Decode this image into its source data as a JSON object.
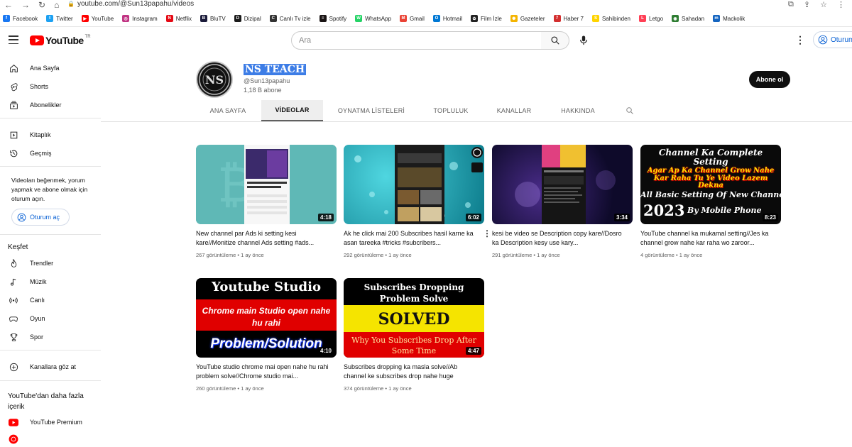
{
  "browser": {
    "url": "youtube.com/@Sun13papahu/videos",
    "bookmarks": [
      {
        "label": "Facebook",
        "color": "#1877f2",
        "glyph": "f"
      },
      {
        "label": "Twitter",
        "color": "#1da1f2",
        "glyph": "t"
      },
      {
        "label": "YouTube",
        "color": "#ff0000",
        "glyph": "▶"
      },
      {
        "label": "Instagram",
        "color": "#c13584",
        "glyph": "◎"
      },
      {
        "label": "Netflix",
        "color": "#e50914",
        "glyph": "N"
      },
      {
        "label": "BluTV",
        "color": "#1b1b3a",
        "glyph": "B"
      },
      {
        "label": "Dizipal",
        "color": "#1a1a1a",
        "glyph": "D"
      },
      {
        "label": "Canlı Tv izle",
        "color": "#333333",
        "glyph": "C"
      },
      {
        "label": "Spotify",
        "color": "#191414",
        "glyph": "≡"
      },
      {
        "label": "WhatsApp",
        "color": "#25d366",
        "glyph": "W"
      },
      {
        "label": "Gmail",
        "color": "#ea4335",
        "glyph": "M"
      },
      {
        "label": "Hotmail",
        "color": "#0078d4",
        "glyph": "O"
      },
      {
        "label": "Film İzle",
        "color": "#222222",
        "glyph": "✿"
      },
      {
        "label": "Gazeteler",
        "color": "#f4b400",
        "glyph": "✺"
      },
      {
        "label": "Haber 7",
        "color": "#d32f2f",
        "glyph": "7"
      },
      {
        "label": "Sahibinden",
        "color": "#ffd400",
        "glyph": "S"
      },
      {
        "label": "Letgo",
        "color": "#ff3f55",
        "glyph": "L"
      },
      {
        "label": "Sahadan",
        "color": "#2e7d32",
        "glyph": "◉"
      },
      {
        "label": "Mackolik",
        "color": "#1565c0",
        "glyph": "m"
      }
    ]
  },
  "header": {
    "logo_text": "YouTube",
    "logo_region": "TR",
    "search_placeholder": "Ara",
    "signin_label": "Oturum"
  },
  "sidebar": {
    "main": [
      "Ana Sayfa",
      "Shorts",
      "Abonelikler"
    ],
    "library": [
      "Kitaplık",
      "Geçmiş"
    ],
    "signin_note": "Videoları beğenmek, yorum yapmak ve abone olmak için oturum açın.",
    "signin_button": "Oturum aç",
    "explore_heading": "Keşfet",
    "explore": [
      "Trendler",
      "Müzik",
      "Canlı",
      "Oyun",
      "Spor"
    ],
    "browse_channels": "Kanallara göz at",
    "more_heading": "YouTube'dan daha fazla içerik",
    "more": [
      "YouTube Premium"
    ]
  },
  "channel": {
    "name": "NS TEACH",
    "handle": "@Sun13papahu",
    "subscribers": "1,18 B abone",
    "subscribe_label": "Abone ol",
    "avatar_letters": "NS"
  },
  "tabs": [
    "ANA SAYFA",
    "VİDEOLAR",
    "OYNATMA LİSTELERİ",
    "TOPLULUK",
    "KANALLAR",
    "HAKKINDA"
  ],
  "active_tab": "VİDEOLAR",
  "videos": [
    {
      "title": "New channel par Ads ki setting kesi kare//Monitize channel Ads setting #ads...",
      "views": "267 görüntüleme",
      "age": "1 ay önce",
      "duration": "4:18",
      "thumb_text": []
    },
    {
      "title": "Ak he click mai 200 Subscribes hasil karne ka asan tareeka #tricks #subcribers...",
      "views": "292 görüntüleme",
      "age": "1 ay önce",
      "duration": "6:02",
      "thumb_text": []
    },
    {
      "title": "kesi be video se Description copy kare//Dosro ka Description kesy use kary...",
      "views": "291 görüntüleme",
      "age": "1 ay önce",
      "duration": "3:34",
      "thumb_text": []
    },
    {
      "title": "YouTube channel ka mukamal setting//Jes ka channel grow nahe kar raha wo zaroor...",
      "views": "4 görüntüleme",
      "age": "1 ay önce",
      "duration": "8:23",
      "thumb_text": [
        "Channel Ka Complete Setting",
        "Agar Ap Ka Channel Grow Nahe Kar Raha Tu Ye Video Lazem Dekna",
        "All Basic Setting Of New Channe",
        "2023",
        "By Mobile Phone"
      ]
    },
    {
      "title": "YouTube studio chrome mai open nahe hu rahi problem solve//Chrome studio mai...",
      "views": "260 görüntüleme",
      "age": "1 ay önce",
      "duration": "4:10",
      "thumb_text": [
        "Youtube Studio",
        "Chrome main Studio open nahe hu rahi",
        "Problem/Solution"
      ]
    },
    {
      "title": "Subscribes dropping ka masla solve//Ab channel ke subscribes drop nahe huge",
      "views": "374 görüntüleme",
      "age": "1 ay önce",
      "duration": "4:47",
      "thumb_text": [
        "Subscribes Dropping Problem Solve",
        "SOLVED",
        "Why You Subscribes Drop After Some Time"
      ]
    }
  ]
}
